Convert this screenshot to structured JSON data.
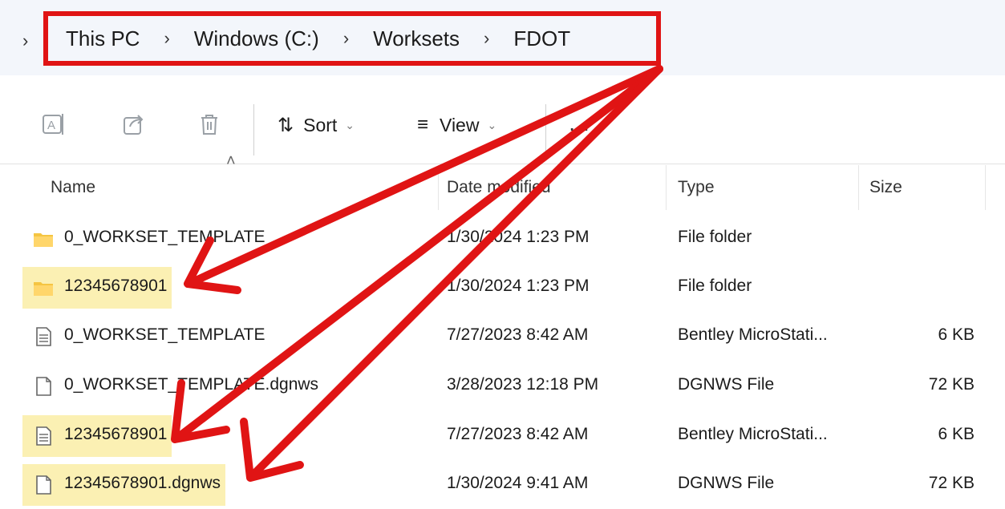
{
  "address": {
    "crumbs": [
      "This PC",
      "Windows (C:)",
      "Worksets",
      "FDOT"
    ]
  },
  "toolbar": {
    "sort_label": "Sort",
    "view_label": "View",
    "more_label": "…"
  },
  "columns": {
    "name": "Name",
    "date": "Date modified",
    "type": "Type",
    "size": "Size"
  },
  "files": [
    {
      "name": "0_WORKSET_TEMPLATE",
      "date": "1/30/2024 1:23 PM",
      "type": "File folder",
      "size": "",
      "icon": "folder-icon",
      "highlight": false
    },
    {
      "name": "12345678901",
      "date": "1/30/2024 1:23 PM",
      "type": "File folder",
      "size": "",
      "icon": "folder-icon",
      "highlight": true
    },
    {
      "name": "0_WORKSET_TEMPLATE",
      "date": "7/27/2023 8:42 AM",
      "type": "Bentley MicroStati...",
      "size": "6 KB",
      "icon": "document-icon",
      "highlight": false
    },
    {
      "name": "0_WORKSET_TEMPLATE.dgnws",
      "date": "3/28/2023 12:18 PM",
      "type": "DGNWS File",
      "size": "72 KB",
      "icon": "blank-file-icon",
      "highlight": false
    },
    {
      "name": "12345678901",
      "date": "7/27/2023 8:42 AM",
      "type": "Bentley MicroStati...",
      "size": "6 KB",
      "icon": "document-icon",
      "highlight": true
    },
    {
      "name": "12345678901.dgnws",
      "date": "1/30/2024 9:41 AM",
      "type": "DGNWS File",
      "size": "72 KB",
      "icon": "blank-file-icon",
      "highlight": true
    }
  ],
  "colors": {
    "highlight": "#fbf0b3",
    "annotation_red": "#e01414",
    "folder_yellow": "#f5c542"
  }
}
